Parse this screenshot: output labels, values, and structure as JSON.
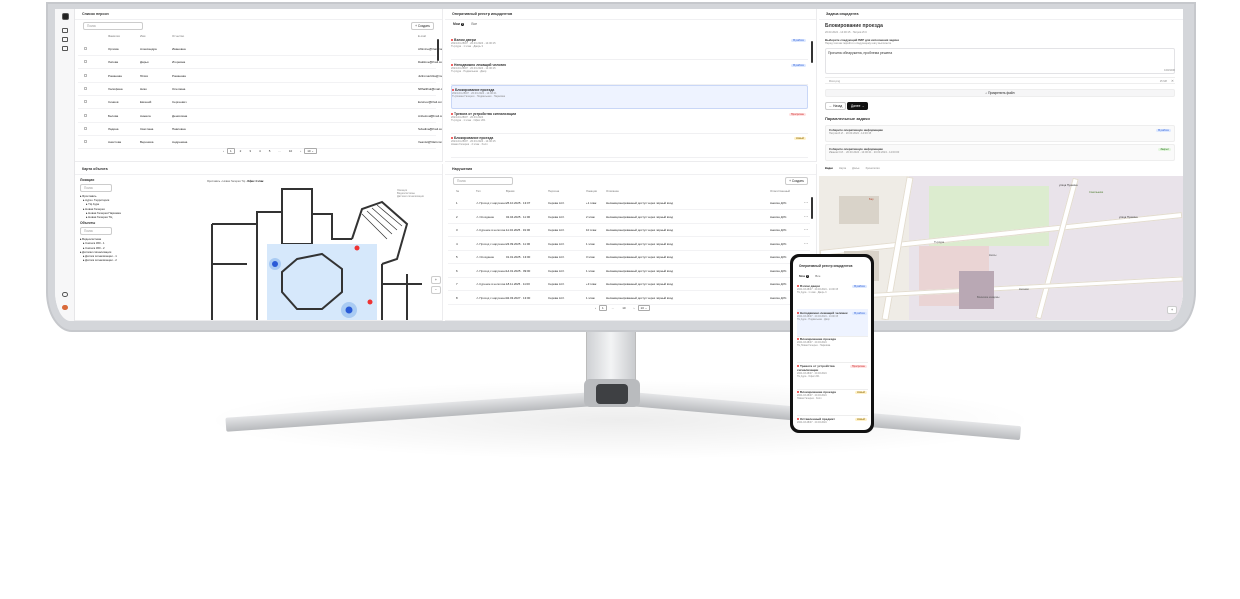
{
  "left_top": {
    "title": "Список персон",
    "search_placeholder": "Поиск",
    "create": "+ Создать",
    "headers": [
      "Фамилия",
      "Имя",
      "Отчество",
      "E-mail"
    ],
    "rows": [
      [
        "Орлова",
        "Александра",
        "Ивановна",
        "Af4mine@mail.com"
      ],
      [
        "Лисова",
        "Дарья",
        "Игоревна",
        "Dakilove@mail.com"
      ],
      [
        "Романова",
        "Юлия",
        "Романова",
        "Jullromanova@mail.com"
      ],
      [
        "Халифина",
        "Нико",
        "Олеговна",
        "N8halifina@mail.com"
      ],
      [
        "Синиов",
        "Евгений",
        "Сергеевич",
        "Evsinov@mail.com"
      ],
      [
        "Белова",
        "Анжела",
        "Денисовна",
        "Anbelova@mail.com"
      ],
      [
        "Ладина",
        "Светлана",
        "Павловна",
        "Svladina@mail.com"
      ],
      [
        "Анистова",
        "Вероника",
        "Андреевна",
        "Veanist@mail.com"
      ]
    ],
    "pagination": [
      "1",
      "2",
      "3",
      "4",
      "5",
      "...",
      "10"
    ],
    "per_page": "10"
  },
  "left_bottom": {
    "title": "Карта объекта",
    "locations": "Локации",
    "search": "Поиск",
    "tree": [
      "Ярославль",
      "Аура • Территория",
      "ТЦ Аура",
      "Новая Галерея",
      "Новая Галерея Парковка",
      "Новая Галерея ТЦ"
    ],
    "objects": "Объекты",
    "objects_search": "Поиск",
    "obj_tree": [
      "Видеосистема",
      "Camera 360 - 1",
      "Camera 360 - 2",
      "Датчики сигнализации",
      "Датчик сигнализации - 1",
      "Датчик сигнализации - 2"
    ],
    "breadcrumb": [
      "Ярославль",
      "Новая Галерея ТЦ",
      "Офис 4 этаж"
    ],
    "legend": [
      "Локации",
      "Видеосистемы",
      "Датчики сигнализации"
    ]
  },
  "mid_top": {
    "title": "Оперативный реестр инцидентов",
    "tabs": [
      "Мои",
      "Все"
    ],
    "mine_count": "1",
    "items": [
      {
        "title": "Взлом двери",
        "meta": "2024-03-28/07 · 20.03.2024 - 14:00:15",
        "loc": "ТЦ Аура · 1 этаж · Дверь 3",
        "badge": "В работе",
        "bc": "#dce8ff",
        "bt": "#2a5bd7"
      },
      {
        "title": "Неподвижно лежащий человек",
        "meta": "2024-03-28/07 · 20.03.2024 - 14:00:15",
        "loc": "ТЦ Аура · Подвальная · Двор",
        "badge": "В работе",
        "bc": "#dce8ff",
        "bt": "#2a5bd7"
      },
      {
        "title": "Блокирование проезда",
        "meta": "2024-03-28/07 · 20.03.2024 - 14:00:21",
        "loc": "ТЦ Новая Галерея · Подвальная · Парковка",
        "badge": "",
        "bc": "",
        "bt": ""
      },
      {
        "title": "Тревога от устройства сигнализации",
        "meta": "2024-03-28/07 · 20.03.2024",
        "loc": "ТЦ Аура · 1 этаж · Офис 201",
        "badge": "Просрочен",
        "bc": "#ffe2e2",
        "bt": "#c22"
      },
      {
        "title": "Блокирование проезда",
        "meta": "2024-03-28/07 · 20.03.2024 - 14:00:15",
        "loc": "Новая Галерея · 2 этаж · Холл",
        "badge": "Новый",
        "bc": "#fff1c7",
        "bt": "#8a6500"
      }
    ]
  },
  "mid_bottom": {
    "title": "Нарушения",
    "search": "Поиск",
    "create": "+ Создать",
    "headers": [
      "№",
      "Тип",
      "Время",
      "Персона",
      "Локация",
      "Описание",
      "Ответственный"
    ],
    "rows": [
      [
        "1",
        "Проход с нарушени...",
        "25.10.2025",
        "13:07",
        "Серова А.И.",
        "+1 этаж",
        "Несанкционированный доступ через чёрный вход",
        "Аносин Д.Ю."
      ],
      [
        "2",
        "Опоздание",
        "02.04.2025",
        "11:00",
        "Серова А.И.",
        "2 этаж",
        "Несанкционированный доступ через чёрный вход",
        "Аносин Д.Ю."
      ],
      [
        "3",
        "Курение в неполож...",
        "11.04.2025",
        "19:00",
        "Серова А.И.",
        "10 этаж",
        "Несанкционированный доступ через чёрный вход",
        "Аносин Д.Ю."
      ],
      [
        "4",
        "Проход с нарушени...",
        "23.09.2025",
        "11:00",
        "Серова А.И.",
        "1 этаж",
        "Несанкционированный доступ через чёрный вход",
        "Аносин Д.Ю."
      ],
      [
        "5",
        "Опоздание",
        "01.01.2025",
        "13:00",
        "Серова А.И.",
        "3 этаж",
        "Несанкционированный доступ через чёрный вход",
        "Аносин Д.Ю."
      ],
      [
        "6",
        "Проход с нарушени...",
        "14.01.2025",
        "09:00",
        "Серова А.И.",
        "1 этаж",
        "Несанкционированный доступ через чёрный вход",
        "Аносин Д.Ю."
      ],
      [
        "7",
        "Курение в неполож...",
        "18.11.2025",
        "11:00",
        "Серова А.И.",
        "+3 этаж",
        "Несанкционированный доступ через чёрный вход",
        "Аносин Д.Ю."
      ],
      [
        "8",
        "Проход с нарушени...",
        "02.03.2027",
        "13:00",
        "Серова А.И.",
        "1 этаж",
        "Несанкционированный доступ через чёрный вход",
        "Аносин Д.Ю."
      ]
    ],
    "pagination": [
      "1",
      "...",
      "10"
    ],
    "per_page": "10"
  },
  "right": {
    "title": "Задача инцидента",
    "task": "Блокирование проезда",
    "task_meta": "20.03.2024 - 14:00:15",
    "assignee": "Петров И.И.",
    "step": "Выберите следующий ПИР для исполнения задачи",
    "step_hint": "Перед тем как перейти к следующему шагу выполните",
    "reason": "Причина обнаружена, проблема решена",
    "counter": "100/1000",
    "file": "Фото.png",
    "file_size": "15 Мб",
    "attach": "Прикрепить файл",
    "back": "Назад",
    "next": "Далее",
    "parallel": "Параллельные задачи",
    "ptasks": [
      {
        "t": "Соберите оперативную информацию",
        "m": "Петров И.И. · 20.03.2024 - 14:00:15",
        "b": "В работе"
      },
      {
        "t": "Соберите оперативную информацию",
        "m": "Иванов И.И. · 20.03.2024 - 14:00:21 · 20.03.2024 - 14:00:00",
        "b": "Закрыт"
      }
    ],
    "tabs": [
      "Видео",
      "Карта",
      "Досье",
      "Хронология"
    ],
    "map_labels": [
      "улица Пушкина",
      "улица Пушкина",
      "Сокольники",
      "Кассы",
      "Касаево",
      "ТЦ Аура",
      "Воинские казармы",
      "Бар"
    ]
  },
  "phone": {
    "title": "Оперативный реестр инцидентов",
    "tabs": [
      "Мои",
      "Все"
    ],
    "mine_count": "1",
    "items": [
      {
        "title": "Взлом двери",
        "meta": "2024-03-28/07 · 20.03.2024 - 14:00:15",
        "loc": "ТЦ Аура · 1 этаж · Дверь 3",
        "badge": "В работе"
      },
      {
        "title": "Неподвижно лежащий человек",
        "meta": "2024-03-28/07 · 20.03.2024 - 14:00:15",
        "loc": "ТЦ Аура · Подвальная · Двор",
        "badge": "В работе"
      },
      {
        "title": "Блокирование проезда",
        "meta": "2024-03-28/07 · 20.03.2024",
        "loc": "ТЦ Новая Галерея · Парковка",
        "badge": ""
      },
      {
        "title": "Тревога от устройства сигнализации",
        "meta": "2024-03-28/07 · 20.03.2024",
        "loc": "ТЦ Аура · Офис 201",
        "badge": "Просрочен"
      },
      {
        "title": "Блокирование проезда",
        "meta": "2024-03-28/07 · 20.03.2024",
        "loc": "Новая Галерея · Холл",
        "badge": "Новый"
      },
      {
        "title": "Оставленный предмет",
        "meta": "2024-03-28/07 · 20.03.2024",
        "loc": "",
        "badge": "Новый"
      }
    ]
  }
}
